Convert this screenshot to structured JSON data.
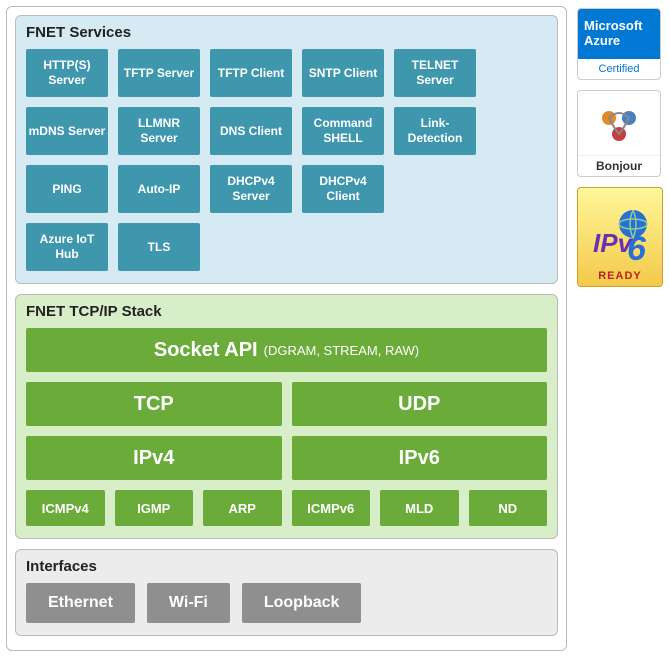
{
  "services": {
    "title": "FNET Services",
    "rows": [
      [
        "HTTP(S) Server",
        "TFTP Server",
        "TFTP Client",
        "SNTP Client",
        "TELNET Server"
      ],
      [
        "mDNS Server",
        "LLMNR Server",
        "DNS Client",
        "Command SHELL",
        "Link-Detection"
      ],
      [
        "PING",
        "Auto-IP",
        "DHCPv4 Server",
        "DHCPv4 Client"
      ],
      [
        "Azure IoT Hub",
        "TLS"
      ]
    ]
  },
  "stack": {
    "title": "FNET TCP/IP Stack",
    "socket_api": "Socket API",
    "socket_api_sub": "(DGRAM, STREAM, RAW)",
    "transport": [
      "TCP",
      "UDP"
    ],
    "network": [
      "IPv4",
      "IPv6"
    ],
    "aux": [
      "ICMPv4",
      "IGMP",
      "ARP",
      "ICMPv6",
      "MLD",
      "ND"
    ]
  },
  "interfaces": {
    "title": "Interfaces",
    "items": [
      "Ethernet",
      "Wi-Fi",
      "Loopback"
    ]
  },
  "badges": {
    "azure_title": "Microsoft Azure",
    "azure_sub": "Certified",
    "bonjour": "Bonjour",
    "ipv6_ready": "READY"
  },
  "colors": {
    "service_box": "#3f97ae",
    "stack_box": "#6bab3a",
    "iface_box": "#8f8f8f",
    "services_panel": "#d5eaf2",
    "stack_panel": "#d8eec8"
  }
}
